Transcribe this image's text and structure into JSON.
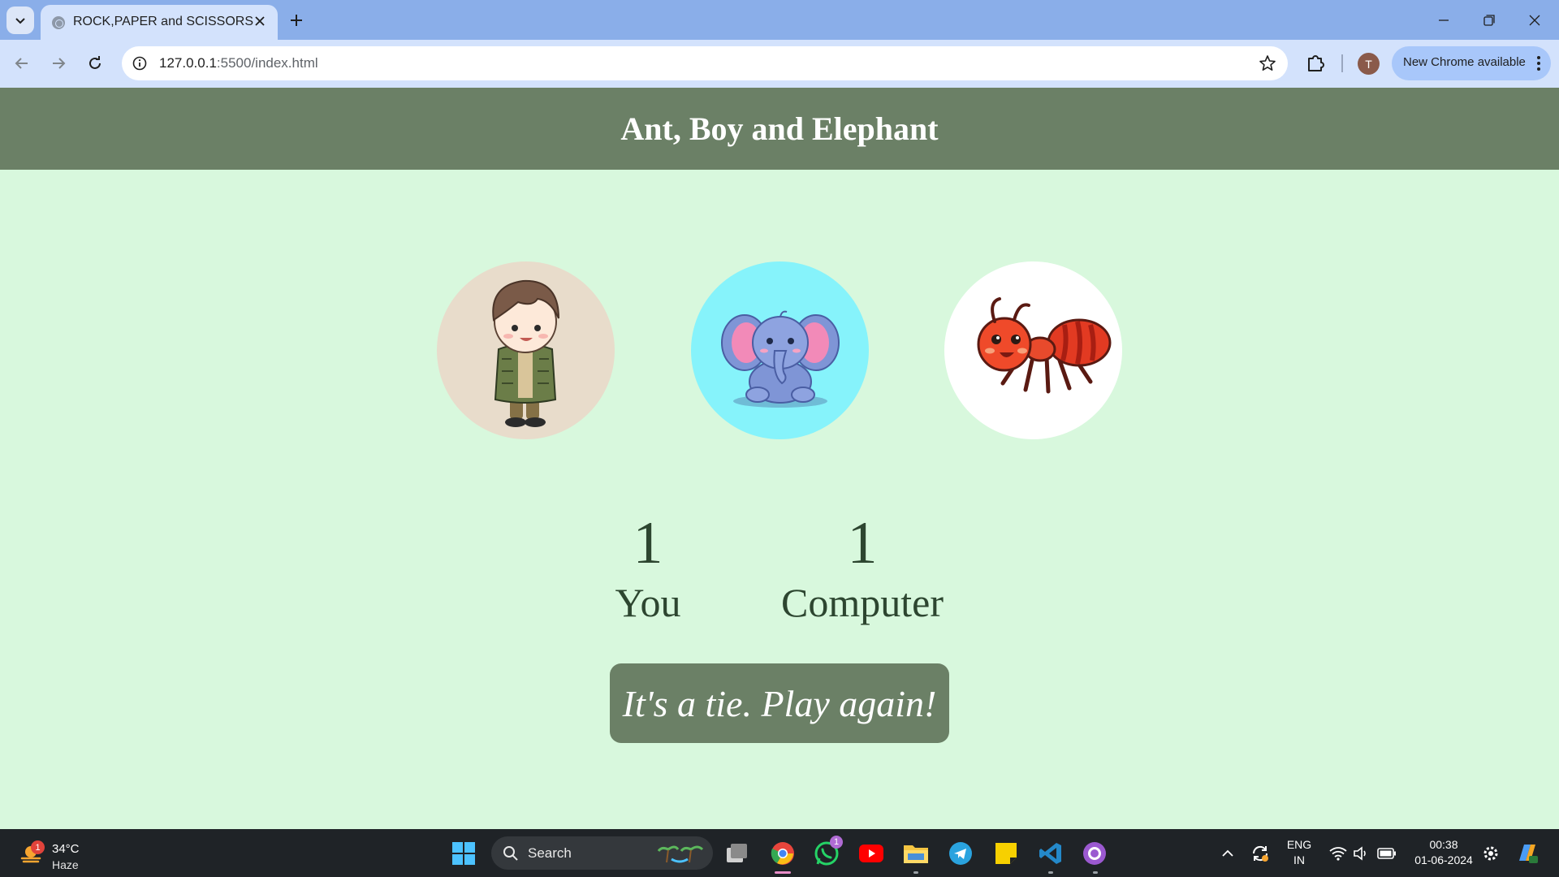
{
  "browser": {
    "tab_title": "ROCK,PAPER and SCISSORS",
    "url_host": "127.0.0.1",
    "url_rest": ":5500/index.html",
    "profile_initial": "T",
    "update_label": "New Chrome available"
  },
  "page": {
    "heading": "Ant, Boy and Elephant",
    "choices": [
      {
        "id": "boy",
        "bg": "#e8dccb"
      },
      {
        "id": "elephant",
        "bg": "#86f3fb"
      },
      {
        "id": "ant",
        "bg": "#ffffff"
      }
    ],
    "user_score": "1",
    "user_label": "You",
    "computer_score": "1",
    "computer_label": "Computer",
    "message": "It's a tie. Play again!",
    "colors": {
      "header": "#6b8066",
      "background": "#d8f8dd",
      "text": "#2d4630"
    }
  },
  "taskbar": {
    "weather_badge": "1",
    "temperature": "34°C",
    "condition": "Haze",
    "search_label": "Search",
    "whatsapp_badge": "1",
    "lang_1": "ENG",
    "lang_2": "IN",
    "time": "00:38",
    "date": "01-06-2024"
  }
}
